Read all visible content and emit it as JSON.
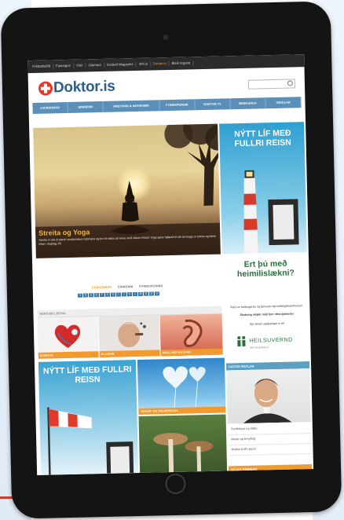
{
  "topbar": {
    "links": [
      "Fréttablaðið",
      "Fasteignir",
      "Vísir",
      "Glamour",
      "Iceland Magazine",
      "mbl.is",
      "Doktor.is",
      "Bleik tegund"
    ],
    "active_index": 6
  },
  "site": {
    "logo_text": "Doktor.is",
    "nav": [
      "SJÚKDÓMAR",
      "EINKENNI",
      "HREYFING & MATARÆÐI",
      "FYRIRSPURNIR",
      "DOKTOR TV",
      "MEÐGANGA",
      "TENGLAR"
    ]
  },
  "hero": {
    "title": "Streita og Yoga",
    "text": "Streita er eitt af stærri vandamálum nútímans og því til mikils að vinna með réttum lífsstíl. Yoga getur hjálpað til við að draga úr streitu og bæta líðan í daglegu lífi."
  },
  "ad_top": {
    "title": "NÝTT LÍF MEÐ FULLRI REISN"
  },
  "tabs": {
    "items": [
      "SJÚKDÓMAR",
      "EINKENNI",
      "FYRIRSPURNIR"
    ],
    "active_index": 0,
    "letters": [
      "A",
      "B",
      "D",
      "E",
      "F",
      "G",
      "H",
      "I",
      "J",
      "K",
      "L",
      "M",
      "N",
      "O",
      "S"
    ]
  },
  "section": {
    "label": "SÉRSVIÐ LÆKNA"
  },
  "thumbs": [
    {
      "label": "HJARTAÐ"
    },
    {
      "label": "ELLIÁRIN"
    },
    {
      "label": "HALS, NEF OG EYRU"
    }
  ],
  "ad_health": {
    "title": "Ert þú með heimilislækni?",
    "line1": "Ráð um heilsugæslu og þjónustu hjá heilbrigðisstofnunum",
    "line2": "Skráning skiptir máli fyrir rétta þjónustu",
    "line3": "Sjá nánari upplýsingar á vef",
    "brand": "HEILSUVERND",
    "sub": "HEILSUGÆSLA"
  },
  "fastir": {
    "head": "FASTIR PISTLAR",
    "links": [
      "Svefnleysi og líðan",
      "Matur og hreyfing",
      "Heilsa á efri árum"
    ]
  },
  "footer_head": "NÝJAR GREINAR",
  "ad_bottom": {
    "title": "NÝTT LÍF MEÐ FULLRI REISN"
  },
  "mid_label": "HUGAR- OG SÁLARHEILSA",
  "colors": {
    "accent": "#f29a2e",
    "nav_blue": "#5b8fb8",
    "logo_blue": "#2e5f8c",
    "logo_red": "#e23a2a",
    "green": "#2b6f3a"
  }
}
